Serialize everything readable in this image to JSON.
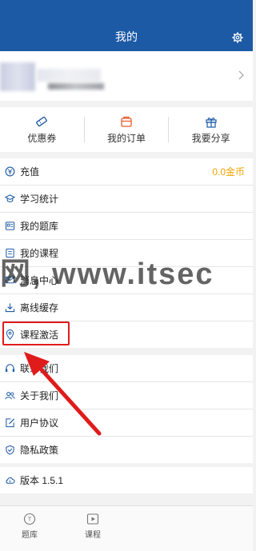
{
  "header": {
    "title": "我的",
    "settings_icon": "gear-icon"
  },
  "quick_actions": [
    {
      "label": "优惠券",
      "icon": "coupon-icon"
    },
    {
      "label": "我的订单",
      "icon": "order-icon"
    },
    {
      "label": "我要分享",
      "icon": "gift-icon"
    }
  ],
  "menu1": [
    {
      "label": "充值",
      "value": "0.0金币",
      "icon": "recharge-icon"
    },
    {
      "label": "学习统计",
      "icon": "graduation-cap-icon"
    },
    {
      "label": "我的题库",
      "icon": "question-bank-icon"
    },
    {
      "label": "我的课程",
      "icon": "course-icon"
    },
    {
      "label": "消息中心",
      "icon": "message-icon"
    },
    {
      "label": "离线缓存",
      "icon": "download-icon"
    },
    {
      "label": "课程激活",
      "icon": "location-pin-icon"
    }
  ],
  "menu2": [
    {
      "label": "联系我们",
      "icon": "headset-icon"
    },
    {
      "label": "关于我们",
      "icon": "people-icon"
    },
    {
      "label": "用户协议",
      "icon": "edit-icon"
    },
    {
      "label": "隐私政策",
      "icon": "shield-icon"
    }
  ],
  "menu3": [
    {
      "label": "版本 1.5.1",
      "icon": "cloud-icon"
    }
  ],
  "watermark": "网, www.itsec",
  "tabbar": [
    {
      "label": "题库",
      "icon": "question-bank-tab-icon"
    },
    {
      "label": "课程",
      "icon": "video-play-icon"
    }
  ],
  "colors": {
    "header": "#1d5aa6",
    "accent": "#f0a300",
    "highlight": "#e01b1b"
  }
}
